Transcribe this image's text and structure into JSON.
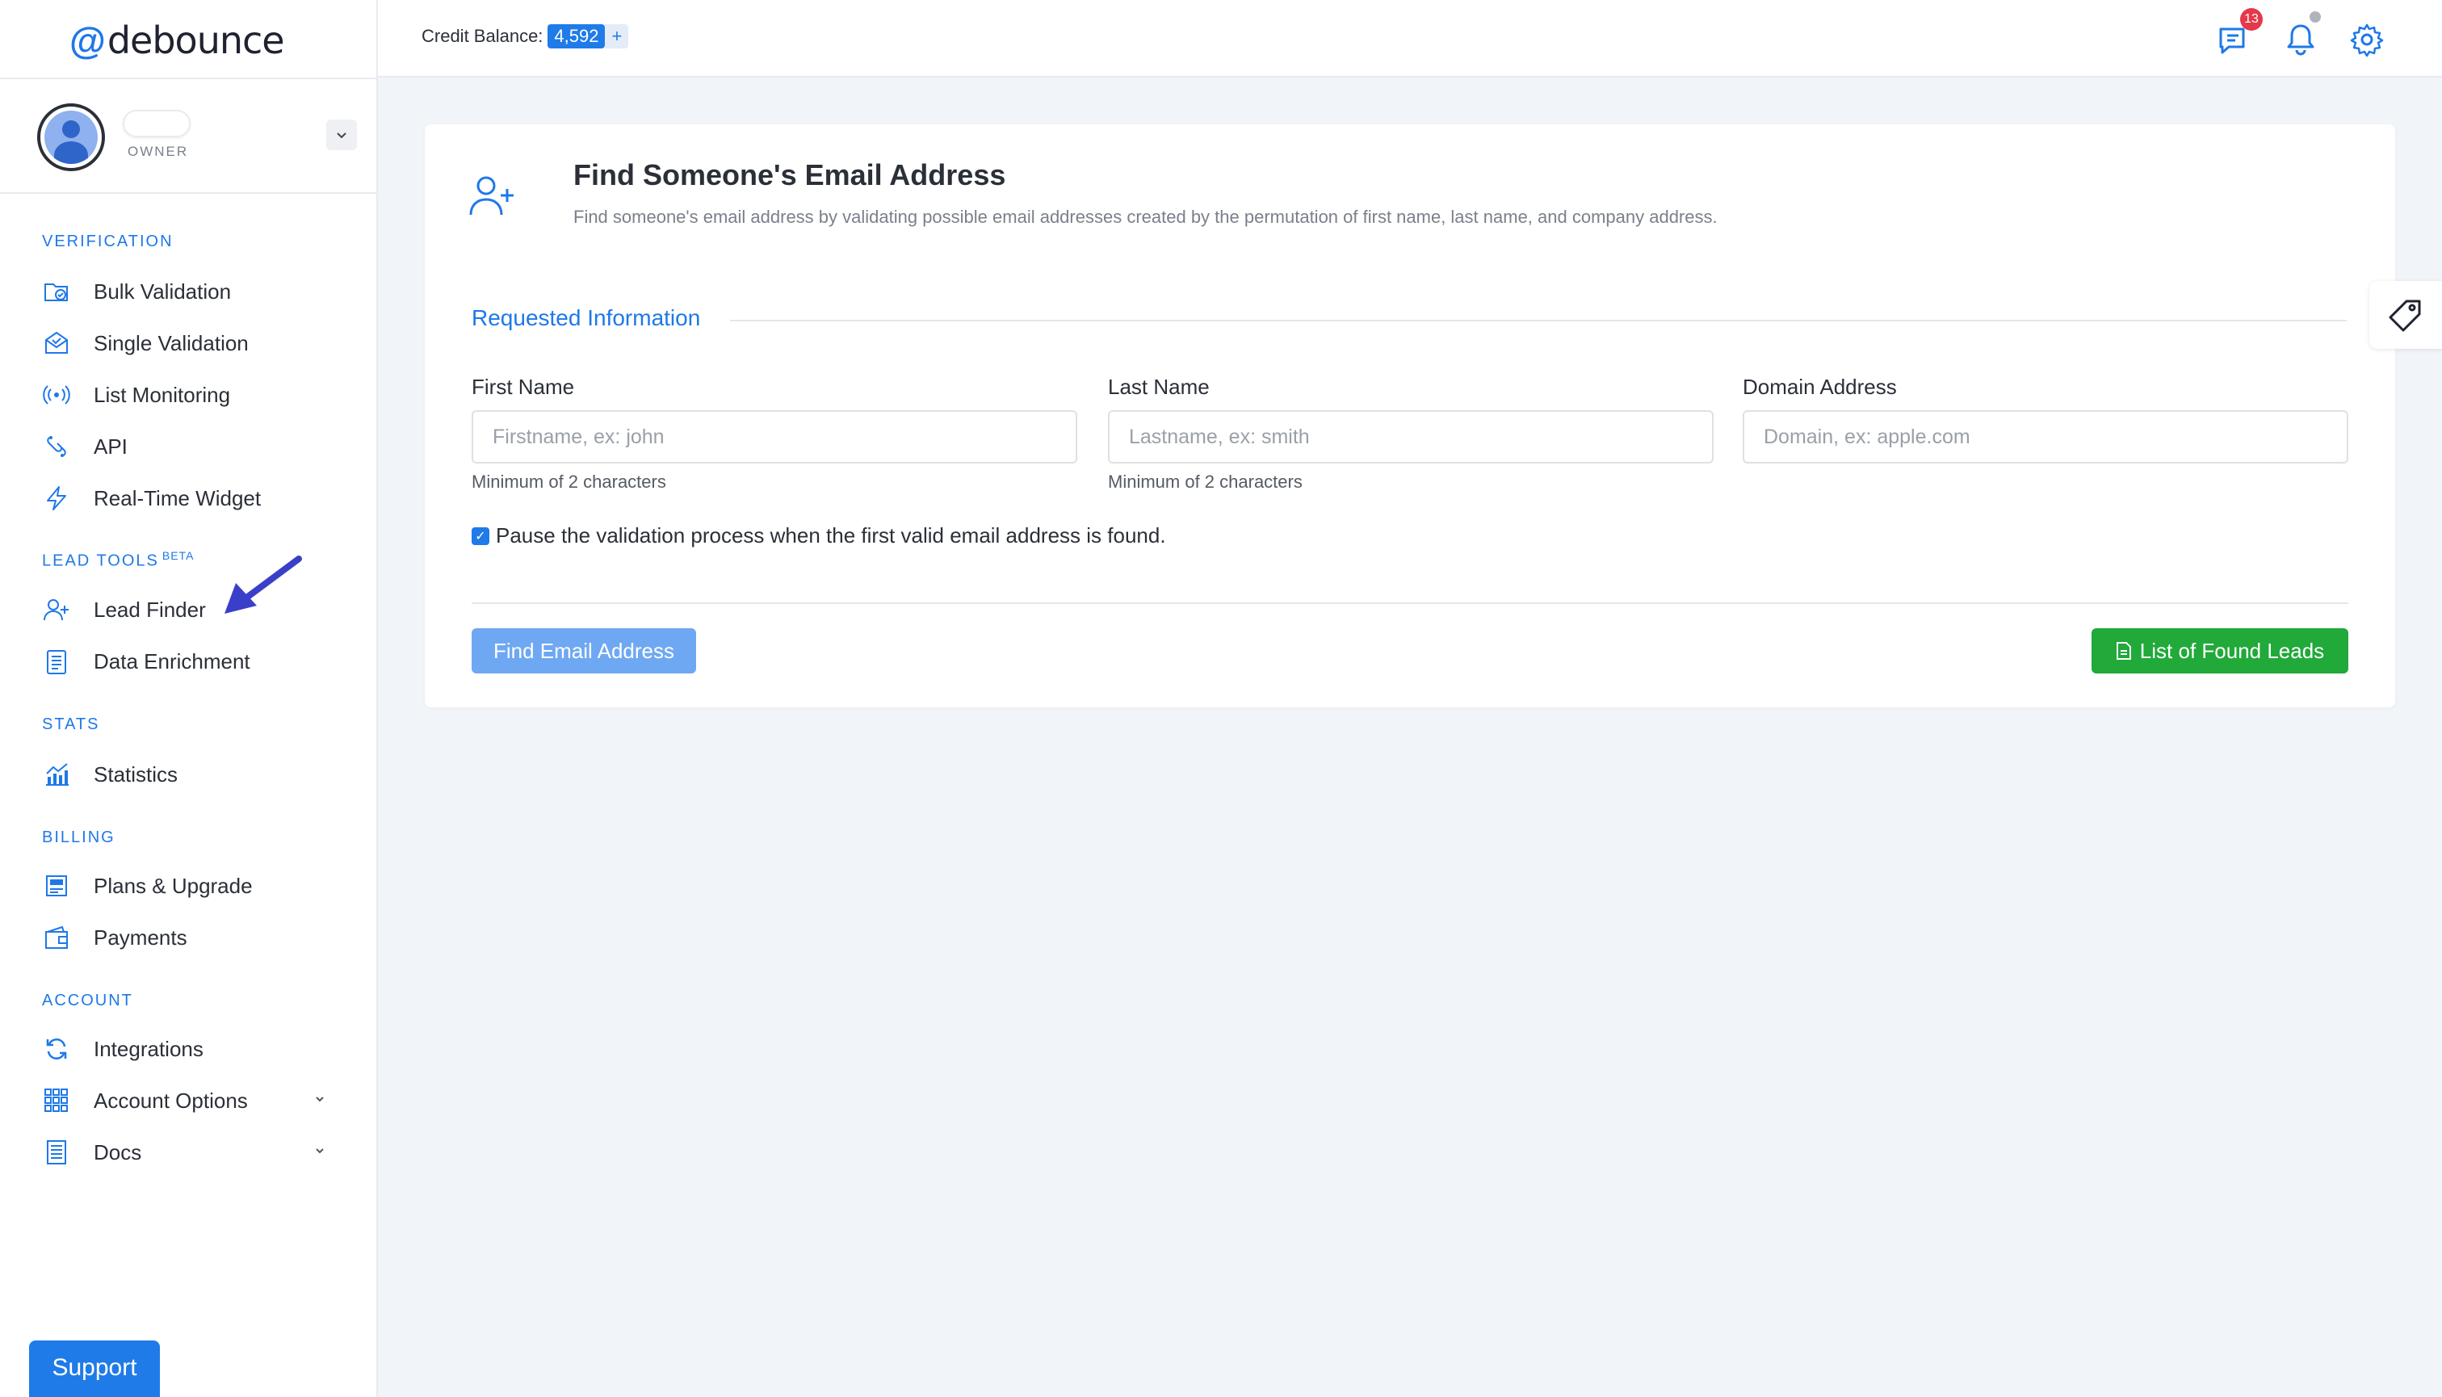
{
  "app": {
    "logo_text": "debounce",
    "logo_at": "@"
  },
  "profile": {
    "role": "OWNER"
  },
  "sidebar": {
    "sections": [
      {
        "label": "VERIFICATION"
      },
      {
        "label": "LEAD TOOLS",
        "badge": "BETA"
      },
      {
        "label": "STATS"
      },
      {
        "label": "BILLING"
      },
      {
        "label": "ACCOUNT"
      }
    ],
    "items": [
      {
        "label": "Bulk Validation",
        "icon": "folder-check-icon"
      },
      {
        "label": "Single Validation",
        "icon": "envelope-check-icon"
      },
      {
        "label": "List Monitoring",
        "icon": "broadcast-icon"
      },
      {
        "label": "API",
        "icon": "api-icon"
      },
      {
        "label": "Real-Time Widget",
        "icon": "lightning-icon"
      },
      {
        "label": "Lead Finder",
        "icon": "user-plus-icon"
      },
      {
        "label": "Data Enrichment",
        "icon": "clipboard-icon"
      },
      {
        "label": "Statistics",
        "icon": "chart-icon"
      },
      {
        "label": "Plans & Upgrade",
        "icon": "plans-icon"
      },
      {
        "label": "Payments",
        "icon": "wallet-icon"
      },
      {
        "label": "Integrations",
        "icon": "refresh-icon"
      },
      {
        "label": "Account Options",
        "icon": "grid-icon"
      },
      {
        "label": "Docs",
        "icon": "document-icon"
      }
    ],
    "support_label": "Support"
  },
  "topbar": {
    "credit_label": "Credit Balance:",
    "credit_value": "4,592",
    "credit_plus": "+",
    "messages_badge": "13"
  },
  "main": {
    "title": "Find Someone's Email Address",
    "description": "Find someone's email address by validating possible email addresses created by the permutation of first name, last name, and company address.",
    "section_title": "Requested Information",
    "fields": [
      {
        "label": "First Name",
        "placeholder": "Firstname, ex: john",
        "hint": "Minimum of 2 characters"
      },
      {
        "label": "Last Name",
        "placeholder": "Lastname, ex: smith",
        "hint": "Minimum of 2 characters"
      },
      {
        "label": "Domain Address",
        "placeholder": "Domain, ex: apple.com",
        "hint": ""
      }
    ],
    "pause_label": "Pause the validation process when the first valid email address is found.",
    "pause_checked": true,
    "find_button": "Find Email Address",
    "leads_button": "List of Found Leads"
  },
  "colors": {
    "accent": "#1e78e8",
    "success": "#21a93a",
    "badge": "#e5384a",
    "annotation_arrow": "#3a3fc9"
  }
}
